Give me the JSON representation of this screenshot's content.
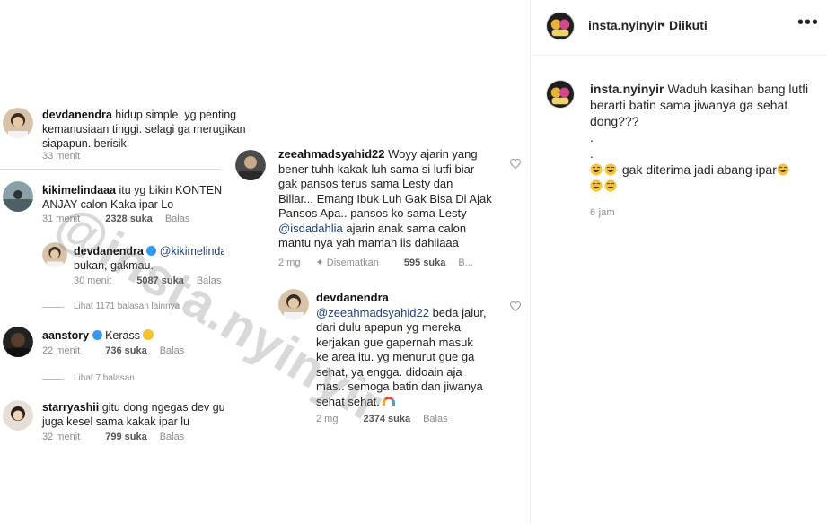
{
  "post": {
    "username": "insta.nyinyir",
    "separator": "•",
    "follow_label": "Diikuti",
    "more_label": "•••",
    "caption_line1": "Waduh kasihan bang lutfi",
    "caption_line2": "berarti batin sama jiwanya ga sehat",
    "caption_line3": "dong???",
    "caption_dot1": ".",
    "caption_dot2": ".",
    "caption_line4": "gak diterima jadi abang ipar",
    "time": "6 jam"
  },
  "watermark": "@insta.nyinyir",
  "left_screenshot": {
    "comments": [
      {
        "user": "devdanendra",
        "text1": "hidup simple, yg penting",
        "text2": "kemanusiaan tinggi. selagi ga merugikan",
        "text3": "siapapun. berisik.",
        "time": "33 menit"
      },
      {
        "user": "kikimelindaaa",
        "text1": "itu yg bikin KONTEN",
        "text2": "ANJAY calon Kaka ipar Lo",
        "time": "31 menit",
        "likes": "2328 suka",
        "reply": "Balas"
      },
      {
        "user": "devdanendra",
        "mention": "@kikimelindaa",
        "text2": "bukan, gakmau.",
        "time": "30 menit",
        "likes": "5087 suka",
        "reply": "Balas"
      },
      {
        "view_more": "Lihat 1171 balasan lainnya"
      },
      {
        "user": "aanstory",
        "text1": "Kerass",
        "time": "22 menit",
        "likes": "736 suka",
        "reply": "Balas"
      },
      {
        "view_more": "Lihat 7 balasan"
      },
      {
        "user": "starryashii",
        "text1": "gitu dong ngegas dev gua",
        "text2": "juga kesel sama kakak ipar lu",
        "time": "32 menit",
        "likes": "799 suka",
        "reply": "Balas"
      }
    ]
  },
  "right_screenshot": {
    "comments": [
      {
        "user": "zeeahmadsyahid22",
        "text1": "Woyy ajarin yang",
        "text2": "bener tuhh kakak luh sama si lutfi biar",
        "text3": "gak pansos terus sama Lesty dan",
        "text4": "Billar... Emang Ibuk Luh Gak Bisa Di Ajak",
        "text5": "Pansos Apa.. pansos ko sama Lesty",
        "mention": "@isdadahlia",
        "text6": " ajarin anak sama calon",
        "text7": "mantu nya yah mamah iis dahliaaa",
        "time": "2 mg",
        "pinned": "Disematkan",
        "likes": "595 suka",
        "reply": "B..."
      },
      {
        "user": "devdanendra",
        "mention": "@zeeahmadsyahid22",
        "text1": " beda jalur,",
        "text2": "dari dulu apapun yg mereka",
        "text3": "kerjakan gue gapernah masuk",
        "text4": "ke area itu. yg menurut gue ga",
        "text5": "sehat, ya engga. didoain aja",
        "text6": "mas.. semoga batin dan jiwanya",
        "text7": "sehat sehat.",
        "time": "2 mg",
        "likes": "2374 suka",
        "reply": "Balas"
      }
    ]
  },
  "icons": {
    "heart": "heart-outline-icon",
    "pin": "pin-icon",
    "verified": "verified-badge-icon",
    "laugh": "tears-of-joy-emoji",
    "rainbow": "rainbow-emoji",
    "emoji_shocked": "shocked-face-emoji"
  },
  "colors": {
    "link": "#1f3e7a",
    "muted": "#8e8e8e",
    "verified": "#3897f0"
  }
}
